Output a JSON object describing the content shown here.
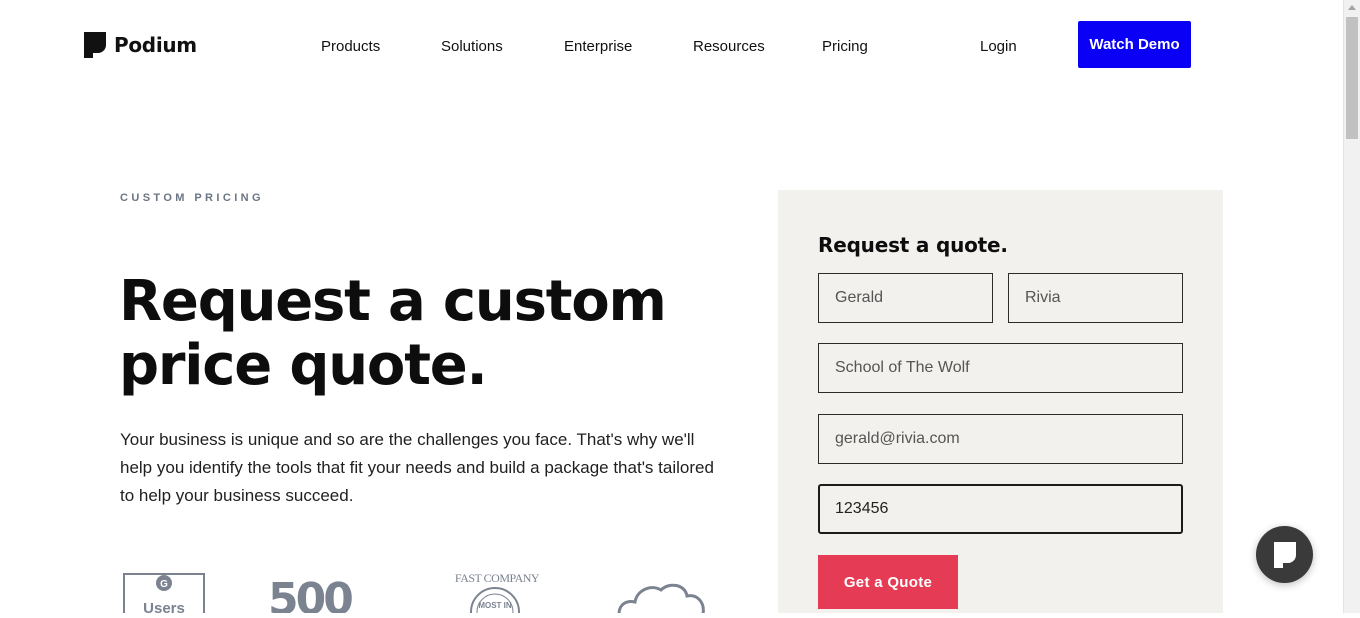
{
  "header": {
    "logo_text": "Podium",
    "nav": [
      "Products",
      "Solutions",
      "Enterprise",
      "Resources",
      "Pricing"
    ],
    "login_label": "Login",
    "demo_label": "Watch Demo"
  },
  "hero": {
    "eyebrow": "CUSTOM PRICING",
    "headline_line1": "Request a custom",
    "headline_line2": "price quote.",
    "description": "Your business is unique and so are the challenges you face. That's why we'll help you identify the tools that fit your needs and build a package that's tailored to help your business succeed."
  },
  "awards": {
    "g2_label": "Users",
    "inc_label": "500",
    "fastcompany_label": "FAST COMPANY",
    "fastcompany_ring": "MOST IN"
  },
  "form": {
    "title": "Request a quote.",
    "first_name": "Gerald",
    "last_name": "Rivia",
    "company": "School of The Wolf",
    "email": "gerald@rivia.com",
    "phone": "123456",
    "submit_label": "Get a Quote"
  },
  "colors": {
    "brand_blue": "#0a00f5",
    "cta_red": "#e63b55",
    "panel_bg": "#f2f1ee",
    "eyebrow_gray": "#6b7584"
  },
  "icons": [
    "podium-logo-icon",
    "g2-badge-icon",
    "inc-500-icon",
    "fastcompany-badge-icon",
    "cloud-icon",
    "chat-icon"
  ]
}
